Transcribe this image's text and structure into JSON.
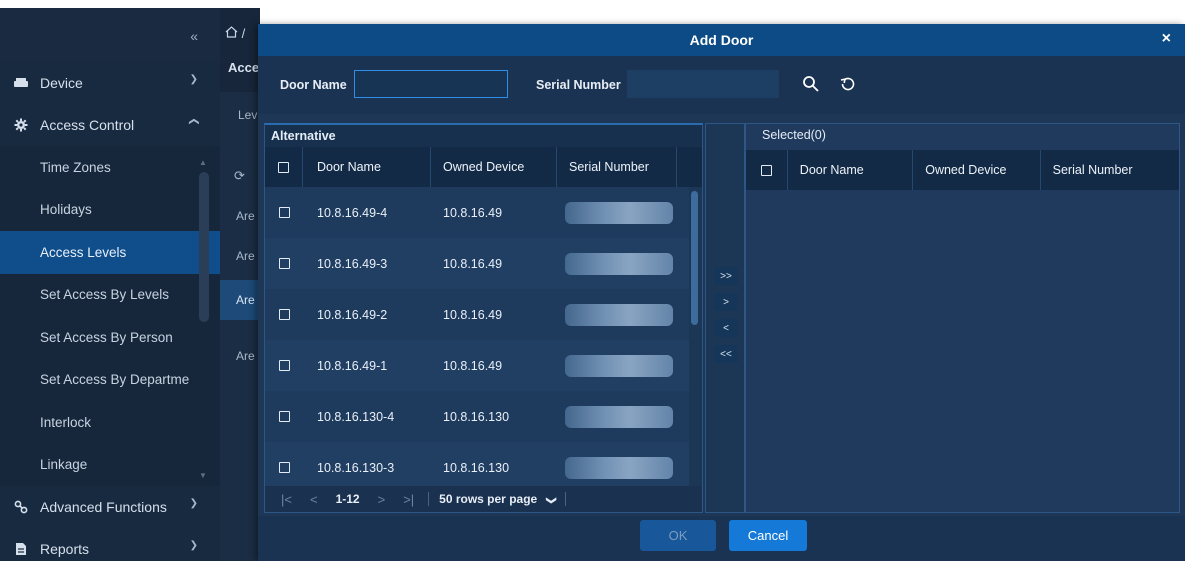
{
  "sidebar": {
    "collapse_glyph": "«",
    "groups": [
      {
        "label": "Device",
        "icon": "device-icon",
        "expanded": false
      },
      {
        "label": "Access Control",
        "icon": "gear-icon",
        "expanded": true
      },
      {
        "label": "Advanced Functions",
        "icon": "advanced-functions-icon",
        "expanded": false
      },
      {
        "label": "Reports",
        "icon": "reports-icon",
        "expanded": false
      }
    ],
    "access_items": [
      "Time Zones",
      "Holidays",
      "Access Levels",
      "Set Access By Levels",
      "Set Access By Person",
      "Set Access By Departme",
      "Interlock",
      "Linkage"
    ],
    "active_item": "Access Levels"
  },
  "background": {
    "breadcrumb_sep": "/",
    "heading": "Acce",
    "sub": "Lev",
    "rows": [
      "Are",
      "Are",
      "Are",
      "Are"
    ]
  },
  "dialog": {
    "title": "Add Door",
    "close_glyph": "×",
    "filters": {
      "door_name_label": "Door Name",
      "door_name_value": "",
      "serial_label": "Serial Number",
      "serial_value": ""
    },
    "alternative": {
      "label": "Alternative",
      "columns": [
        "Door Name",
        "Owned Device",
        "Serial Number"
      ],
      "rows": [
        {
          "door": "10.8.16.49-4",
          "device": "10.8.16.49"
        },
        {
          "door": "10.8.16.49-3",
          "device": "10.8.16.49"
        },
        {
          "door": "10.8.16.49-2",
          "device": "10.8.16.49"
        },
        {
          "door": "10.8.16.49-1",
          "device": "10.8.16.49"
        },
        {
          "door": "10.8.16.130-4",
          "device": "10.8.16.130"
        },
        {
          "door": "10.8.16.130-3",
          "device": "10.8.16.130"
        }
      ],
      "pager": {
        "first": "|<",
        "prev": "<",
        "range": "1-12",
        "next": ">",
        "last": ">|",
        "rows_per_page": "50 rows per page"
      }
    },
    "transfer": {
      "add_all": ">>",
      "add": ">",
      "remove": "<",
      "remove_all": "<<"
    },
    "selected": {
      "label": "Selected(0)",
      "columns": [
        "Door Name",
        "Owned Device",
        "Serial Number"
      ]
    },
    "footer": {
      "ok": "OK",
      "cancel": "Cancel"
    }
  },
  "colors": {
    "title_bar": "#0d4b86",
    "accent": "#1479d7",
    "sidebar_bg": "#17263a",
    "active_nav": "#0f4e8a"
  }
}
